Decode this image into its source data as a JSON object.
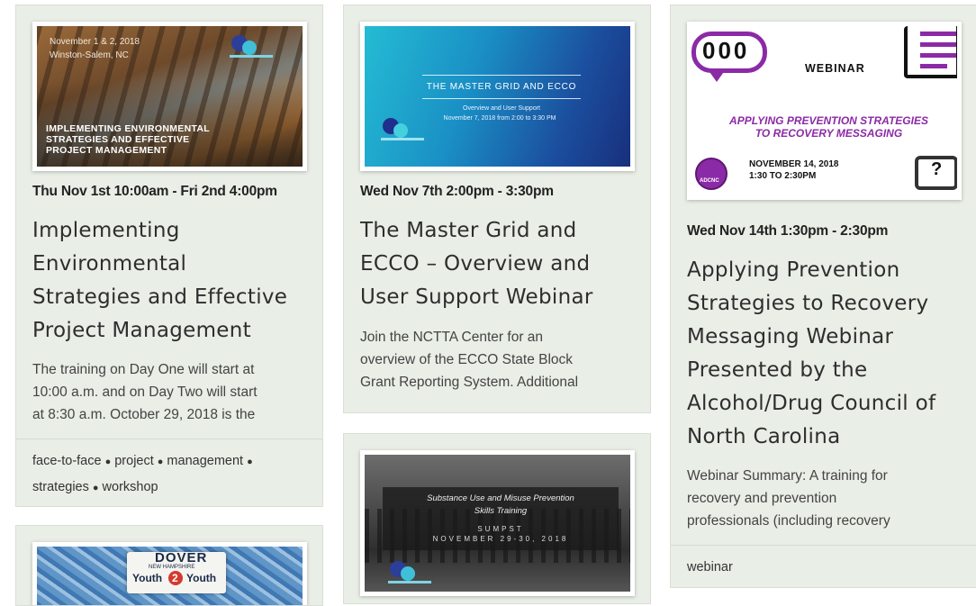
{
  "cards": [
    {
      "date": "Thu Nov 1st 10:00am - Fri 2nd 4:00pm",
      "title_lines": [
        "Implementing",
        "Environmental",
        "Strategies and Effective",
        "Project Management"
      ],
      "summary_lines": [
        "The training on Day One will start at",
        "10:00 a.m. and on Day Two will start",
        "at 8:30 a.m. October 29, 2018 is the"
      ],
      "tags": [
        "face-to-face",
        "project",
        "management",
        "strategies",
        "workshop"
      ],
      "image": {
        "date_line": "November 1 & 2, 2018",
        "place_line": "Winston-Salem, NC",
        "caption_lines": [
          "IMPLEMENTING ENVIRONMENTAL",
          "STRATEGIES AND EFFECTIVE",
          "PROJECT MANAGEMENT"
        ]
      }
    },
    {
      "date": "Wed Nov 7th 2:00pm - 3:30pm",
      "title_lines": [
        "The Master Grid and",
        "ECCO – Overview and",
        "User Support Webinar"
      ],
      "summary_lines": [
        "Join the NCTTA Center for an",
        "overview of the ECCO State Block",
        "Grant Reporting System. Additional"
      ],
      "image": {
        "heading": "THE MASTER GRID AND ECCO",
        "sub1": "Overview and User Support",
        "sub2": "November 7, 2018 from 2:00 to 3:30 PM"
      }
    },
    {
      "date": "Wed Nov 14th 1:30pm - 2:30pm",
      "title_lines": [
        "Applying Prevention",
        "Strategies to Recovery",
        "Messaging Webinar",
        "Presented by the",
        "Alcohol/Drug Council of",
        "North Carolina"
      ],
      "summary_lines": [
        "Webinar Summary: A training for",
        "recovery and prevention",
        "professionals (including recovery"
      ],
      "tags": [
        "webinar"
      ],
      "image": {
        "webinar": "WEBINAR",
        "headline_lines": [
          "APPLYING PREVENTION STRATEGIES",
          "TO RECOVERY MESSAGING"
        ],
        "when_lines": [
          "NOVEMBER 14, 2018",
          "1:30 TO 2:30PM"
        ],
        "badge": "ADCNC",
        "bubble": "000",
        "question": "?"
      }
    },
    {
      "image": {
        "line1": "Substance Use and Misuse Prevention",
        "line2": "Skills Training",
        "line3": "SUMPST",
        "line4": "NOVEMBER 29-30, 2018"
      }
    },
    {
      "image": {
        "line1": "DOVER",
        "line2": "NEW HAMPSHIRE",
        "line3": "Youth",
        "line4": "2",
        "line5": "Youth"
      }
    }
  ],
  "colors": {
    "card_bg": "#e9eee6",
    "purple": "#8b2aa6",
    "blue_gradient_start": "#22b7d1",
    "blue_gradient_end": "#173a8c"
  }
}
